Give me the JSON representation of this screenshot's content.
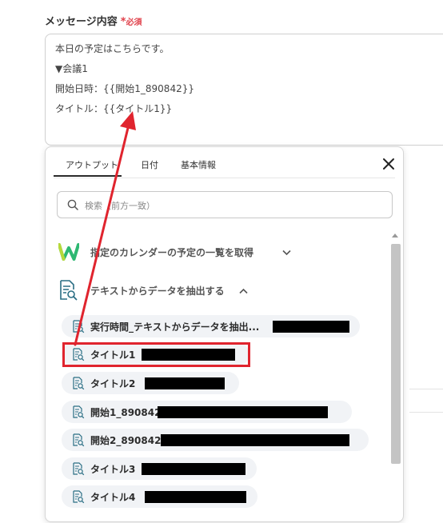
{
  "field": {
    "label": "メッセージ内容",
    "required_mark": "*",
    "required_text": "必須"
  },
  "message_lines": [
    "本日の予定はこちらです。",
    "▼会議1",
    "開始日時：{{開始1_890842}}",
    "タイトル：{{タイトル1}}"
  ],
  "panel": {
    "tabs": [
      "アウトプット",
      "日付",
      "基本情報"
    ],
    "active_tab": "アウトプット",
    "search_placeholder": "検索（前方一致）",
    "groups": [
      {
        "name": "指定のカレンダーの予定の一覧を取得",
        "icon": "w-logo-icon",
        "expanded": false
      },
      {
        "name": "テキストからデータを抽出する",
        "icon": "document-search-icon",
        "expanded": true
      }
    ],
    "items": [
      {
        "name": "実行時間_テキストからデータを抽出..."
      },
      {
        "name": "タイトル1"
      },
      {
        "name": "タイトル2"
      },
      {
        "name": "開始1_890842"
      },
      {
        "name": "開始2_890842"
      },
      {
        "name": "タイトル3"
      },
      {
        "name": "タイトル4"
      }
    ]
  },
  "colors": {
    "accent_red": "#e0242e",
    "required_red": "#e0404a",
    "logo_green": "#2eb872"
  }
}
